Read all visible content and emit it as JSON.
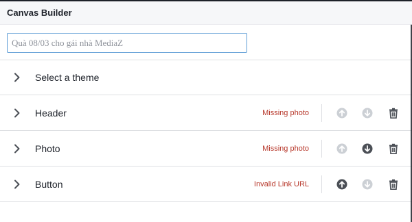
{
  "app": {
    "title": "Canvas Builder"
  },
  "search": {
    "value": "Quà 08/03 cho gái nhà MediaZ"
  },
  "rows": [
    {
      "label": "Select a theme",
      "error": "",
      "has_controls": false
    },
    {
      "label": "Header",
      "error": "Missing photo",
      "has_controls": true,
      "up_enabled": false,
      "down_enabled": false
    },
    {
      "label": "Photo",
      "error": "Missing photo",
      "has_controls": true,
      "up_enabled": false,
      "down_enabled": true
    },
    {
      "label": "Button",
      "error": "Invalid Link URL",
      "has_controls": true,
      "up_enabled": true,
      "down_enabled": false
    }
  ],
  "colors": {
    "error": "#b7372a",
    "icon_enabled": "#4b4f56",
    "icon_disabled": "#ccd0d5",
    "input_border": "#5b9bd5"
  },
  "icons": {
    "expand": "chevron-right-icon",
    "move_up": "arrow-up-circle-icon",
    "move_down": "arrow-down-circle-icon",
    "delete": "trash-icon"
  }
}
